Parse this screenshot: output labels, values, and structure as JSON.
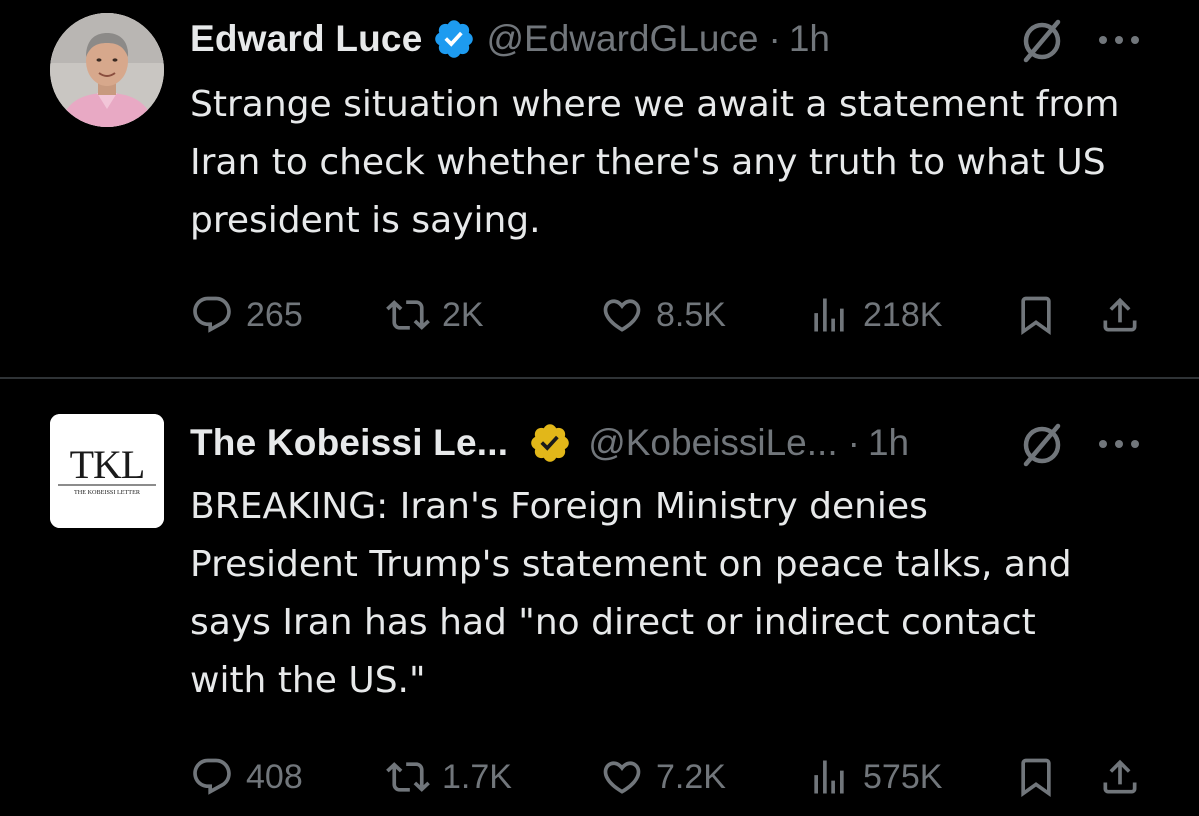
{
  "tweets": [
    {
      "author": {
        "name": "Edward Luce",
        "handle": "@EdwardGLuce",
        "verified": "blue-verified-badge"
      },
      "separator": "·",
      "time": "1h",
      "text": "Strange situation where we await a statement from Iran to check whether there's any truth to what US president is saying.",
      "stats": {
        "replies": "265",
        "reposts": "2K",
        "likes": "8.5K",
        "views": "218K"
      }
    },
    {
      "author": {
        "name": "The Kobeissi Le...",
        "handle": "@KobeissiLe...",
        "verified": "gold-verified-badge",
        "logo_text": "TKL",
        "logo_subtext": "THE KOBEISSI LETTER"
      },
      "separator": "·",
      "time": "1h",
      "text": "BREAKING: Iran's Foreign Ministry denies President Trump's statement on peace talks, and says Iran has had \"no direct or indirect contact with the US.\"",
      "stats": {
        "replies": "408",
        "reposts": "1.7K",
        "likes": "7.2K",
        "views": "575K"
      }
    }
  ],
  "colors": {
    "background": "#000000",
    "text_primary": "#e7e9ea",
    "text_secondary": "#71767b",
    "verified_blue": "#1d9bf0",
    "verified_gold": "#e2b719",
    "divider": "#2f3336"
  },
  "icons": [
    "reply-icon",
    "repost-icon",
    "like-icon",
    "views-icon",
    "bookmark-icon",
    "share-icon",
    "grok-icon",
    "more-options-icon"
  ]
}
